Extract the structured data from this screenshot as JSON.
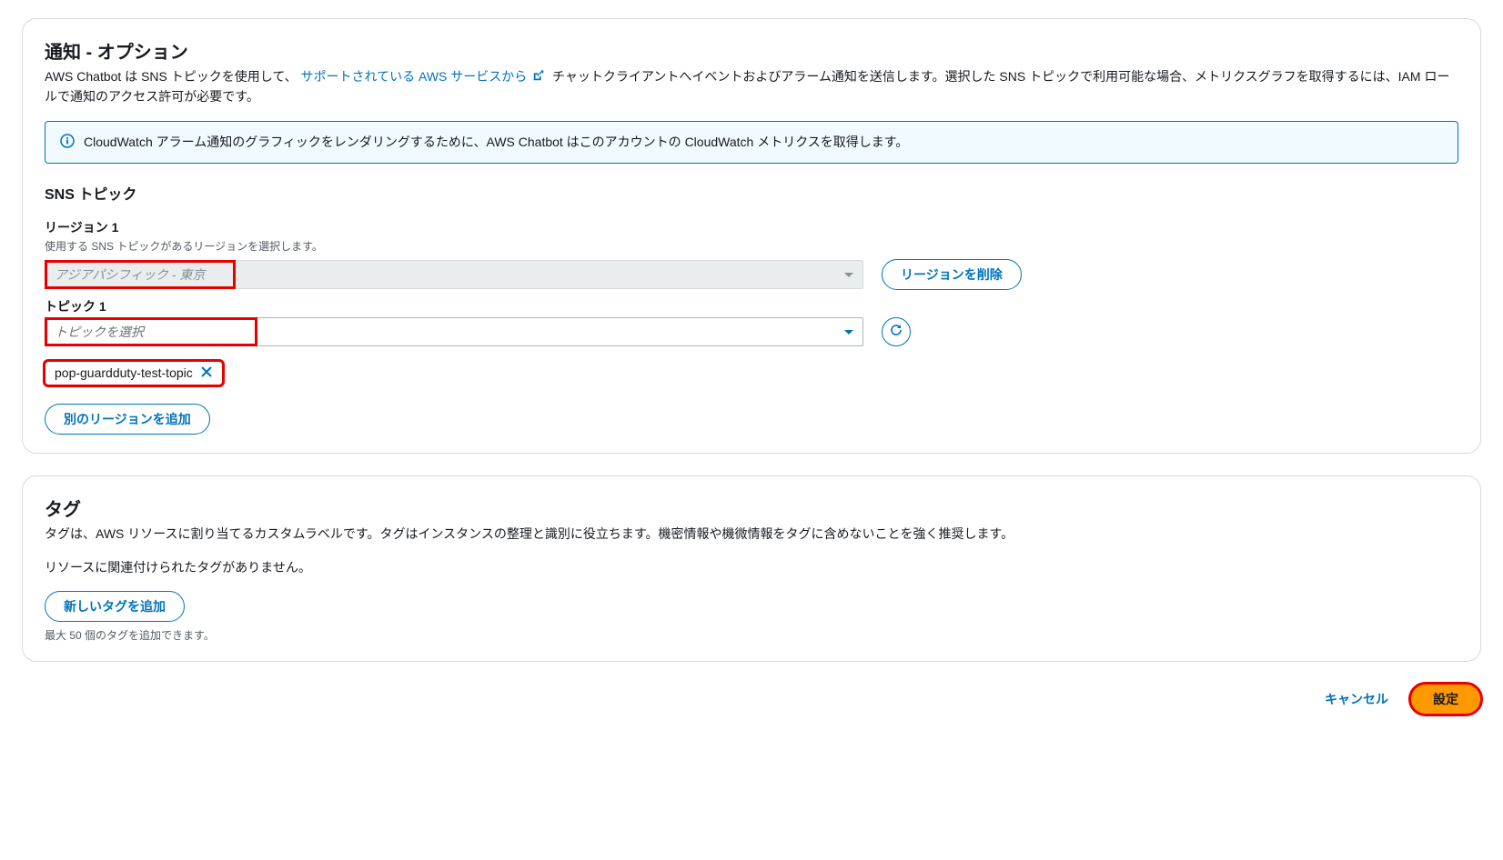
{
  "notifications": {
    "title": "通知 - オプション",
    "desc_pre": "AWS Chatbot は SNS トピックを使用して、",
    "desc_link": "サポートされている AWS サービスから",
    "desc_post": "チャットクライアントへイベントおよびアラーム通知を送信します。選択した SNS トピックで利用可能な場合、メトリクスグラフを取得するには、IAM ロールで通知のアクセス許可が必要です。",
    "info_text": "CloudWatch アラーム通知のグラフィックをレンダリングするために、AWS Chatbot はこのアカウントの CloudWatch メトリクスを取得します。",
    "sns_heading": "SNS トピック",
    "region_label": "リージョン 1",
    "region_hint": "使用する SNS トピックがあるリージョンを選択します。",
    "region_value": "アジアパシフィック - 東京",
    "delete_region_btn": "リージョンを削除",
    "topic_label": "トピック 1",
    "topic_placeholder": "トピックを選択",
    "selected_topic": "pop-guardduty-test-topic",
    "add_region_btn": "別のリージョンを追加"
  },
  "tags": {
    "title": "タグ",
    "desc": "タグは、AWS リソースに割り当てるカスタムラベルです。タグはインスタンスの整理と識別に役立ちます。機密情報や機微情報をタグに含めないことを強く推奨します。",
    "empty": "リソースに関連付けられたタグがありません。",
    "add_btn": "新しいタグを追加",
    "limit": "最大 50 個のタグを追加できます。"
  },
  "footer": {
    "cancel": "キャンセル",
    "submit": "設定"
  }
}
